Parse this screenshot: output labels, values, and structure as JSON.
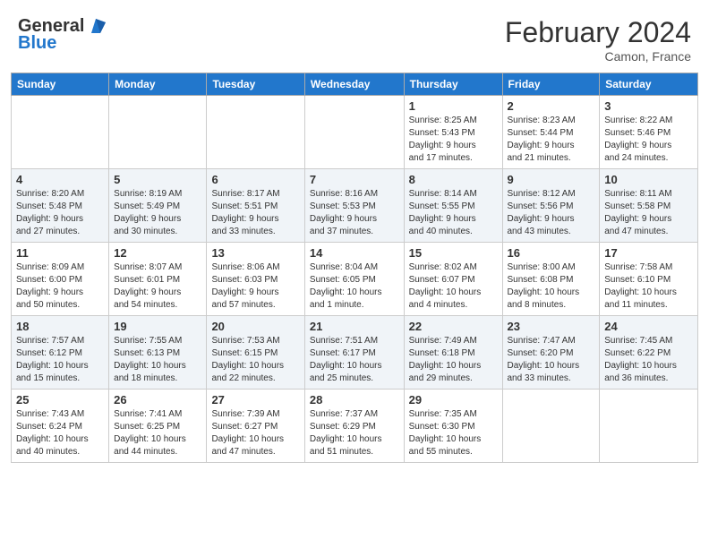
{
  "header": {
    "logo_general": "General",
    "logo_blue": "Blue",
    "title": "February 2024",
    "subtitle": "Camon, France"
  },
  "calendar": {
    "days_of_week": [
      "Sunday",
      "Monday",
      "Tuesday",
      "Wednesday",
      "Thursday",
      "Friday",
      "Saturday"
    ],
    "weeks": [
      [
        {
          "num": "",
          "info": ""
        },
        {
          "num": "",
          "info": ""
        },
        {
          "num": "",
          "info": ""
        },
        {
          "num": "",
          "info": ""
        },
        {
          "num": "1",
          "info": "Sunrise: 8:25 AM\nSunset: 5:43 PM\nDaylight: 9 hours\nand 17 minutes."
        },
        {
          "num": "2",
          "info": "Sunrise: 8:23 AM\nSunset: 5:44 PM\nDaylight: 9 hours\nand 21 minutes."
        },
        {
          "num": "3",
          "info": "Sunrise: 8:22 AM\nSunset: 5:46 PM\nDaylight: 9 hours\nand 24 minutes."
        }
      ],
      [
        {
          "num": "4",
          "info": "Sunrise: 8:20 AM\nSunset: 5:48 PM\nDaylight: 9 hours\nand 27 minutes."
        },
        {
          "num": "5",
          "info": "Sunrise: 8:19 AM\nSunset: 5:49 PM\nDaylight: 9 hours\nand 30 minutes."
        },
        {
          "num": "6",
          "info": "Sunrise: 8:17 AM\nSunset: 5:51 PM\nDaylight: 9 hours\nand 33 minutes."
        },
        {
          "num": "7",
          "info": "Sunrise: 8:16 AM\nSunset: 5:53 PM\nDaylight: 9 hours\nand 37 minutes."
        },
        {
          "num": "8",
          "info": "Sunrise: 8:14 AM\nSunset: 5:55 PM\nDaylight: 9 hours\nand 40 minutes."
        },
        {
          "num": "9",
          "info": "Sunrise: 8:12 AM\nSunset: 5:56 PM\nDaylight: 9 hours\nand 43 minutes."
        },
        {
          "num": "10",
          "info": "Sunrise: 8:11 AM\nSunset: 5:58 PM\nDaylight: 9 hours\nand 47 minutes."
        }
      ],
      [
        {
          "num": "11",
          "info": "Sunrise: 8:09 AM\nSunset: 6:00 PM\nDaylight: 9 hours\nand 50 minutes."
        },
        {
          "num": "12",
          "info": "Sunrise: 8:07 AM\nSunset: 6:01 PM\nDaylight: 9 hours\nand 54 minutes."
        },
        {
          "num": "13",
          "info": "Sunrise: 8:06 AM\nSunset: 6:03 PM\nDaylight: 9 hours\nand 57 minutes."
        },
        {
          "num": "14",
          "info": "Sunrise: 8:04 AM\nSunset: 6:05 PM\nDaylight: 10 hours\nand 1 minute."
        },
        {
          "num": "15",
          "info": "Sunrise: 8:02 AM\nSunset: 6:07 PM\nDaylight: 10 hours\nand 4 minutes."
        },
        {
          "num": "16",
          "info": "Sunrise: 8:00 AM\nSunset: 6:08 PM\nDaylight: 10 hours\nand 8 minutes."
        },
        {
          "num": "17",
          "info": "Sunrise: 7:58 AM\nSunset: 6:10 PM\nDaylight: 10 hours\nand 11 minutes."
        }
      ],
      [
        {
          "num": "18",
          "info": "Sunrise: 7:57 AM\nSunset: 6:12 PM\nDaylight: 10 hours\nand 15 minutes."
        },
        {
          "num": "19",
          "info": "Sunrise: 7:55 AM\nSunset: 6:13 PM\nDaylight: 10 hours\nand 18 minutes."
        },
        {
          "num": "20",
          "info": "Sunrise: 7:53 AM\nSunset: 6:15 PM\nDaylight: 10 hours\nand 22 minutes."
        },
        {
          "num": "21",
          "info": "Sunrise: 7:51 AM\nSunset: 6:17 PM\nDaylight: 10 hours\nand 25 minutes."
        },
        {
          "num": "22",
          "info": "Sunrise: 7:49 AM\nSunset: 6:18 PM\nDaylight: 10 hours\nand 29 minutes."
        },
        {
          "num": "23",
          "info": "Sunrise: 7:47 AM\nSunset: 6:20 PM\nDaylight: 10 hours\nand 33 minutes."
        },
        {
          "num": "24",
          "info": "Sunrise: 7:45 AM\nSunset: 6:22 PM\nDaylight: 10 hours\nand 36 minutes."
        }
      ],
      [
        {
          "num": "25",
          "info": "Sunrise: 7:43 AM\nSunset: 6:24 PM\nDaylight: 10 hours\nand 40 minutes."
        },
        {
          "num": "26",
          "info": "Sunrise: 7:41 AM\nSunset: 6:25 PM\nDaylight: 10 hours\nand 44 minutes."
        },
        {
          "num": "27",
          "info": "Sunrise: 7:39 AM\nSunset: 6:27 PM\nDaylight: 10 hours\nand 47 minutes."
        },
        {
          "num": "28",
          "info": "Sunrise: 7:37 AM\nSunset: 6:29 PM\nDaylight: 10 hours\nand 51 minutes."
        },
        {
          "num": "29",
          "info": "Sunrise: 7:35 AM\nSunset: 6:30 PM\nDaylight: 10 hours\nand 55 minutes."
        },
        {
          "num": "",
          "info": ""
        },
        {
          "num": "",
          "info": ""
        }
      ]
    ]
  }
}
